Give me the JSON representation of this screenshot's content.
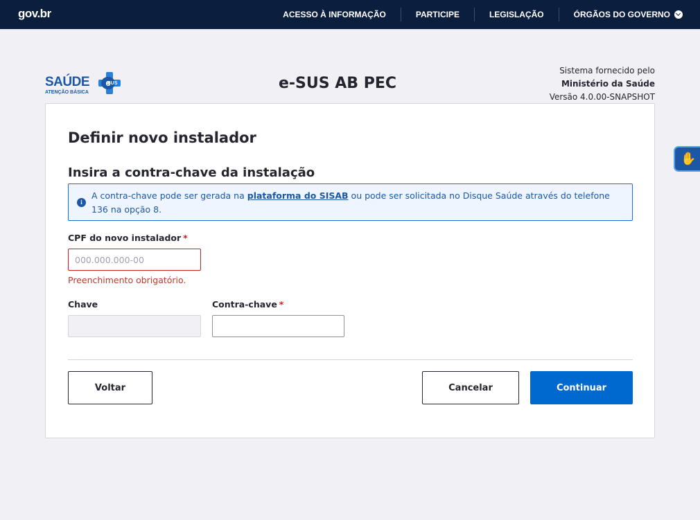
{
  "govbar": {
    "logo": "gov.br",
    "nav": [
      {
        "label": "ACESSO À INFORMAÇÃO"
      },
      {
        "label": "PARTICIPE"
      },
      {
        "label": "LEGISLAÇÃO"
      },
      {
        "label": "ÓRGÃOS DO GOVERNO"
      }
    ]
  },
  "header": {
    "logo_main": "SAÚDE",
    "logo_sub": "ATENÇÃO BÁSICA",
    "logo_badge": "e",
    "logo_badge_sub": "SUS",
    "app_title": "e-SUS AB PEC",
    "system_line1": "Sistema fornecido pelo",
    "system_line2": "Ministério da Saúde",
    "system_line3": "Versão 4.0.00-SNAPSHOT"
  },
  "form": {
    "title": "Definir novo instalador",
    "subtitle": "Insira a contra-chave da instalação",
    "alert_before": "A contra-chave pode ser gerada na ",
    "alert_link": "plataforma do SISAB",
    "alert_after": " ou pode ser solicitada no Disque Saúde através do telefone 136 na opção 8.",
    "cpf_label": "CPF do novo instalador",
    "required_mark": "*",
    "cpf_placeholder": "000.000.000-00",
    "cpf_value": "",
    "cpf_error": "Preenchimento obrigatório.",
    "chave_label": "Chave",
    "chave_value": "",
    "contrachave_label": "Contra-chave",
    "contrachave_value": ""
  },
  "buttons": {
    "back": "Voltar",
    "cancel": "Cancelar",
    "continue": "Continuar"
  },
  "colors": {
    "gov_bar": "#0c1e3e",
    "primary": "#0069d0",
    "error": "#d01c1c",
    "info": "#1c57a5"
  },
  "icons": {
    "chevron": "chevron-down-icon",
    "info": "info-icon",
    "accessibility": "sign-language-icon"
  }
}
